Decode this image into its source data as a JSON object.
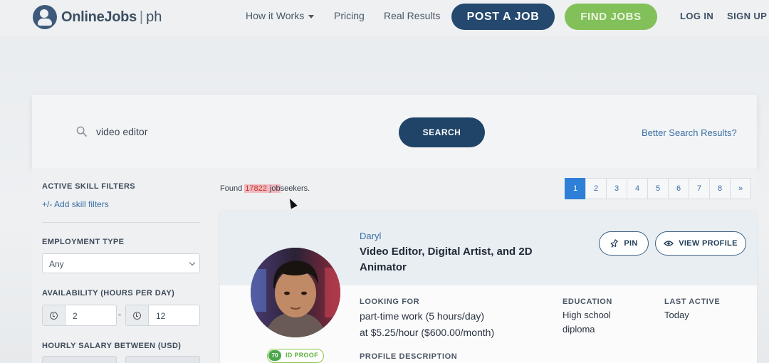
{
  "nav": {
    "logo_text": "OnlineJobs",
    "logo_sep": "|",
    "logo_suffix": "ph",
    "links": [
      "How it Works",
      "Pricing",
      "Real Results"
    ],
    "post_job": "POST A JOB",
    "find_jobs": "FIND JOBS",
    "login": "LOG IN",
    "signup": "SIGN UP"
  },
  "search": {
    "value": "video editor",
    "button": "SEARCH",
    "better_link": "Better Search Results?"
  },
  "sidebar": {
    "active_skill_filters": "ACTIVE SKILL FILTERS",
    "add_skill_filters": "+/- Add skill filters",
    "employment_type": "EMPLOYMENT TYPE",
    "employment_value": "Any",
    "availability": "AVAILABILITY (HOURS PER DAY)",
    "hours_min": "2",
    "hours_max": "12",
    "range_dash": "-",
    "hourly_salary": "HOURLY SALARY BETWEEN (USD)"
  },
  "results": {
    "found_prefix": "Found ",
    "found_count": "17822",
    "found_word_hl": "job",
    "found_word_rest": "seekers.",
    "pages": [
      "1",
      "2",
      "3",
      "4",
      "5",
      "6",
      "7",
      "8",
      "»"
    ],
    "active_page": "1"
  },
  "candidate": {
    "name": "Daryl",
    "title": "Video Editor, Digital Artist, and 2D Animator",
    "pin": "PIN",
    "view_profile": "VIEW PROFILE",
    "id_score": "70",
    "id_proof": "ID PROOF",
    "looking_for_label": "LOOKING FOR",
    "looking_for_line1": "part-time work (5 hours/day)",
    "looking_for_line2": "at $5.25/hour ($600.00/month)",
    "education_label": "EDUCATION",
    "education_line1": "High school",
    "education_line2": "diploma",
    "last_active_label": "LAST ACTIVE",
    "last_active_value": "Today",
    "profile_description_label": "PROFILE DESCRIPTION"
  },
  "icons": [
    "search-icon",
    "caret-down-icon",
    "clock-icon",
    "pin-icon",
    "eye-icon",
    "chevron-down-icon",
    "mouse-cursor-icon"
  ],
  "colors": {
    "primary_navy": "#24486e",
    "find_green": "#82c05a",
    "link_blue": "#3a6fa6",
    "active_page": "#2e7fd8",
    "highlight": "#f2b9bf"
  }
}
